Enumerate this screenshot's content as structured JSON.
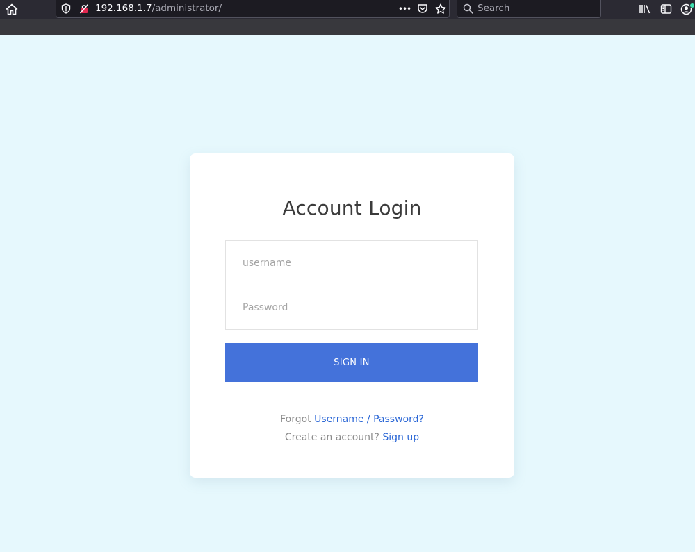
{
  "browser": {
    "url_host": "192.168.1.7",
    "url_path": "/administrator/",
    "more_glyph": "•••",
    "search_placeholder": "Search"
  },
  "login": {
    "title": "Account Login",
    "username_placeholder": "username",
    "password_placeholder": "Password",
    "signin_label": "SIGN IN",
    "forgot_prefix": "Forgot",
    "forgot_link": "Username / Password?",
    "create_prefix": "Create an account?",
    "signup_link": "Sign up"
  },
  "colors": {
    "page_background": "#e6f8fd",
    "card_background": "#ffffff",
    "button": "#4472da",
    "link": "#2b67d6"
  },
  "icons": [
    "home-icon",
    "tracking-shield-icon",
    "insecure-lock-icon",
    "more-icon",
    "pocket-icon",
    "bookmark-star-icon",
    "search-icon",
    "library-icon",
    "sidebar-icon",
    "account-icon"
  ]
}
